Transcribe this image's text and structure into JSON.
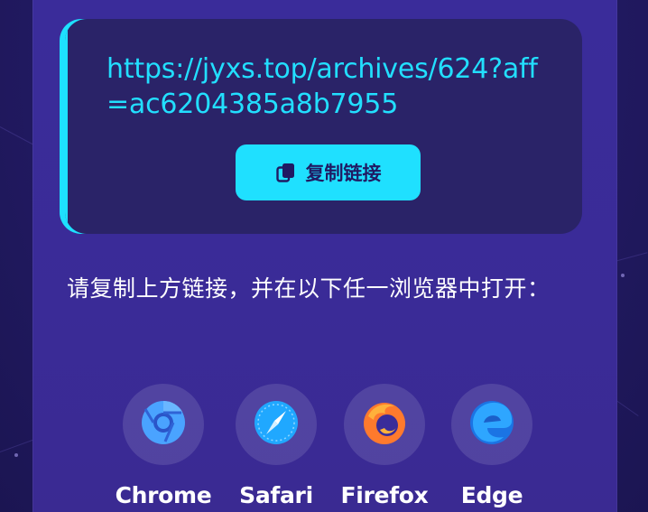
{
  "link_card": {
    "url": "https://jyxs.top/archives/624?aff=ac6204385a8b7955",
    "copy_button_label": "复制链接",
    "copy_icon": "copy-icon"
  },
  "instruction": "请复制上方链接，并在以下任一浏览器中打开：",
  "browsers": [
    {
      "name": "Chrome",
      "icon": "chrome-icon"
    },
    {
      "name": "Safari",
      "icon": "safari-icon"
    },
    {
      "name": "Firefox",
      "icon": "firefox-icon"
    },
    {
      "name": "Edge",
      "icon": "edge-icon"
    }
  ],
  "colors": {
    "accent": "#1ee0ff",
    "card_background": "#2a2368",
    "panel_background": "#3a2c9a",
    "page_background": "#221a63"
  }
}
